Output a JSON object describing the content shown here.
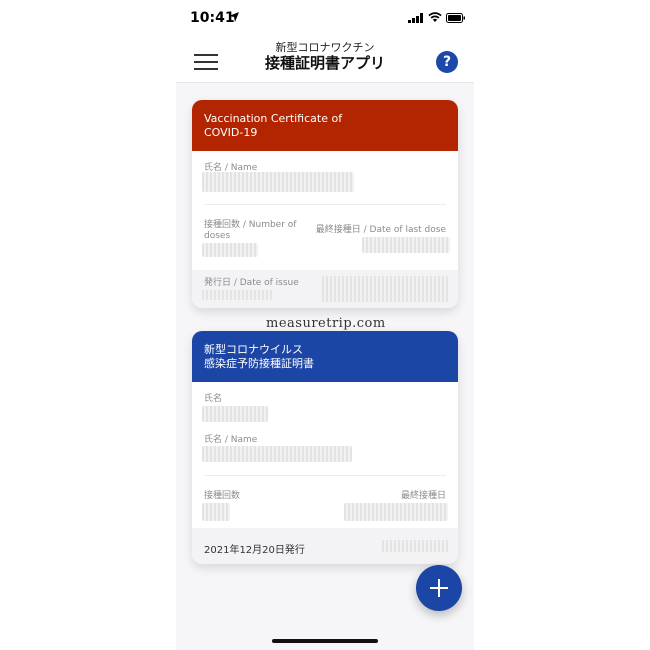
{
  "status_bar": {
    "time": "10:41"
  },
  "app_bar": {
    "subtitle": "新型コロナワクチン",
    "title": "接種証明書アプリ",
    "help_glyph": "?"
  },
  "cards": [
    {
      "header_line1": "Vaccination Certificate of",
      "header_line2": "COVID-19",
      "name_label": "氏名 / Name",
      "doses_label_line1": "接種回数 / Number of",
      "doses_label_line2": "doses",
      "last_dose_label": "最終接種日 / Date of last dose",
      "issue_label": "発行日 / Date of issue",
      "header_color": "#b32400"
    },
    {
      "header_line1": "新型コロナウイルス",
      "header_line2": "感染症予防接種証明書",
      "name_jp_label": "氏名",
      "name_label": "氏名 / Name",
      "doses_label": "接種回数",
      "last_dose_label": "最終接種日",
      "issued_text": "2021年12月20日発行",
      "header_color": "#1c46a6"
    }
  ],
  "watermark": "measuretrip.com",
  "fab": {
    "icon": "plus-icon"
  }
}
